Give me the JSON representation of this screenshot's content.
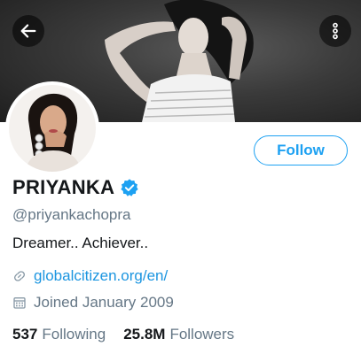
{
  "profile": {
    "name": "PRIYANKA",
    "handle": "@priyankachopra",
    "bio": "Dreamer.. Achiever..",
    "website": "globalcitizen.org/en/",
    "joined": "Joined January 2009",
    "verified": true
  },
  "actions": {
    "follow_label": "Follow"
  },
  "stats": {
    "following_count": "537",
    "following_label": "Following",
    "followers_count": "25.8M",
    "followers_label": "Followers"
  },
  "icons": {
    "back": "back-arrow-icon",
    "more": "more-vertical-icon",
    "verified": "verified-badge-icon",
    "link": "link-icon",
    "calendar": "calendar-icon"
  },
  "colors": {
    "accent": "#1da1f2",
    "link": "#1b95e0",
    "secondary_text": "#657786",
    "primary_text": "#14171a"
  }
}
